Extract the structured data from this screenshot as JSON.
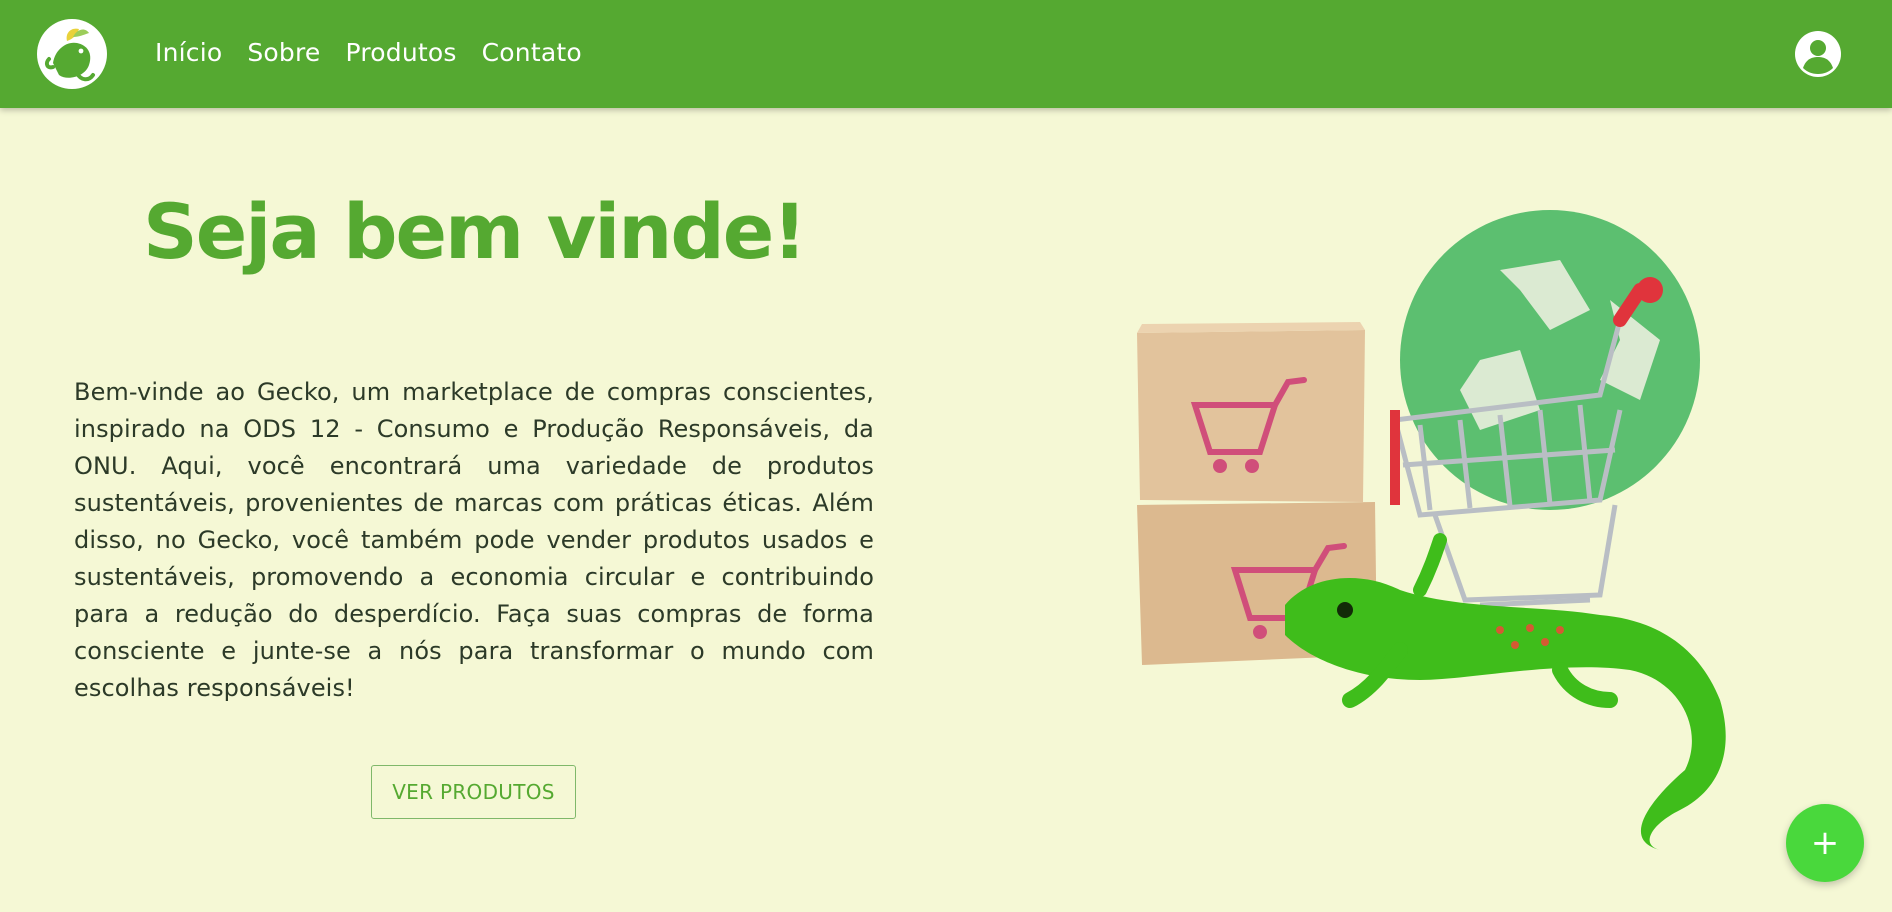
{
  "nav": {
    "logo_icon": "gecko-logo-icon",
    "links": [
      "Início",
      "Sobre",
      "Produtos",
      "Contato"
    ],
    "account_icon": "user-account-icon"
  },
  "hero": {
    "title": "Seja bem vinde!",
    "description": "Bem-vinde ao Gecko, um marketplace de compras conscientes, inspirado na ODS 12 - Consumo e Produção Responsáveis, da ONU. Aqui, você encontrará uma variedade de produtos sustentáveis, provenientes de marcas com práticas éticas. Além disso, no Gecko, você também pode vender produtos usados e sustentáveis, promovendo a economia circular e contribuindo para a redução do desperdício. Faça suas compras de forma consciente e junte-se a nós para transformar o mundo com escolhas responsáveis!",
    "cta_label": "VER PRODUTOS",
    "illustration_icon": "gecko-shopping-cart-recycle-illustration"
  },
  "fab": {
    "label": "+"
  },
  "colors": {
    "brand_green": "#55a931",
    "background": "#f5f8d5",
    "fab_green": "#49d83c",
    "text": "#2c3a28"
  }
}
